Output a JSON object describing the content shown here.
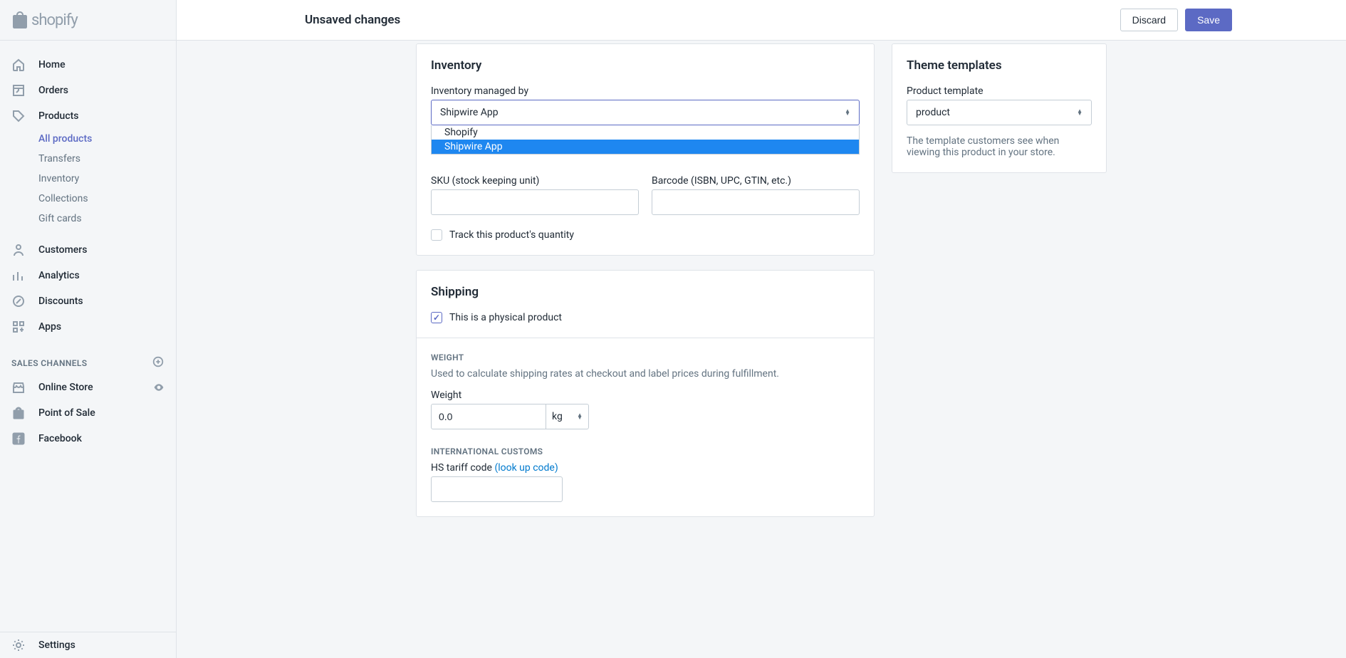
{
  "brand": "shopify",
  "topbar": {
    "title": "Unsaved changes",
    "discard": "Discard",
    "save": "Save"
  },
  "nav": {
    "home": "Home",
    "orders": "Orders",
    "products": "Products",
    "all_products": "All products",
    "transfers": "Transfers",
    "inventory": "Inventory",
    "collections": "Collections",
    "gift_cards": "Gift cards",
    "customers": "Customers",
    "analytics": "Analytics",
    "discounts": "Discounts",
    "apps": "Apps",
    "sales_channels": "SALES CHANNELS",
    "online_store": "Online Store",
    "point_of_sale": "Point of Sale",
    "facebook": "Facebook",
    "settings": "Settings"
  },
  "inventory": {
    "title": "Inventory",
    "managed_label": "Inventory managed by",
    "managed_value": "Shipwire App",
    "options": {
      "opt1": "Shopify",
      "opt2": "Shipwire App"
    },
    "sku_label": "SKU (stock keeping unit)",
    "barcode_label": "Barcode (ISBN, UPC, GTIN, etc.)",
    "track_label": "Track this product's quantity"
  },
  "shipping": {
    "title": "Shipping",
    "physical_label": "This is a physical product",
    "weight_head": "WEIGHT",
    "weight_help": "Used to calculate shipping rates at checkout and label prices during fulfillment.",
    "weight_label": "Weight",
    "weight_value": "0.0",
    "weight_unit": "kg",
    "intl_head": "INTERNATIONAL CUSTOMS",
    "hs_label": "HS tariff code ",
    "hs_link": "(look up code)"
  },
  "themes": {
    "title": "Theme templates",
    "template_label": "Product template",
    "template_value": "product",
    "help": "The template customers see when viewing this product in your store."
  }
}
